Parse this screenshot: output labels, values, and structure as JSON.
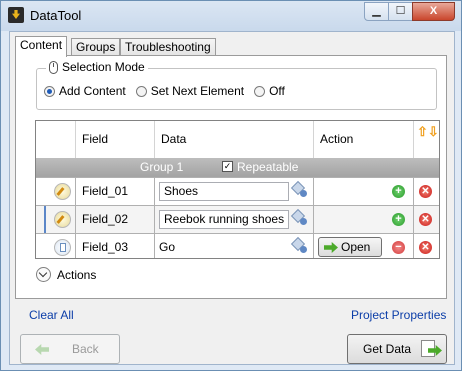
{
  "window": {
    "title": "DataTool",
    "min_glyph": "▁",
    "max_glyph": "☐",
    "close_glyph": "X"
  },
  "tabs": [
    {
      "label": "Content",
      "active": true
    },
    {
      "label": "Groups"
    },
    {
      "label": "Troubleshooting"
    }
  ],
  "selection_mode": {
    "title": "Selection Mode",
    "options": [
      {
        "label": "Add Content",
        "selected": true
      },
      {
        "label": "Set Next Element"
      },
      {
        "label": "Off"
      }
    ]
  },
  "grid": {
    "headers": {
      "field": "Field",
      "data": "Data",
      "action": "Action"
    },
    "group": {
      "name": "Group 1",
      "repeatable_label": "Repeatable",
      "repeatable_checked": true,
      "check_glyph": "✓"
    },
    "rows": [
      {
        "field": "Field_01",
        "data": "Shoes",
        "icon": "edit-icon"
      },
      {
        "field": "Field_02",
        "data": "Reebok running shoes",
        "icon": "edit-icon"
      },
      {
        "field": "Field_03",
        "data": "Go",
        "icon": "document-icon",
        "action_label": "Open"
      }
    ],
    "glyphs": {
      "add": "+",
      "remove": "−",
      "delete": "✕",
      "sort_up": "⇧",
      "sort_down": "⇩"
    }
  },
  "actions_label": "Actions",
  "links": {
    "clear_all": "Clear All",
    "project_properties": "Project Properties"
  },
  "buttons": {
    "back": "Back",
    "get_data": "Get Data"
  },
  "colors": {
    "link": "#0b3da8",
    "add_green": "#2b9a2b",
    "delete_red": "#cc1a1a",
    "sort_orange": "#f0a020"
  }
}
